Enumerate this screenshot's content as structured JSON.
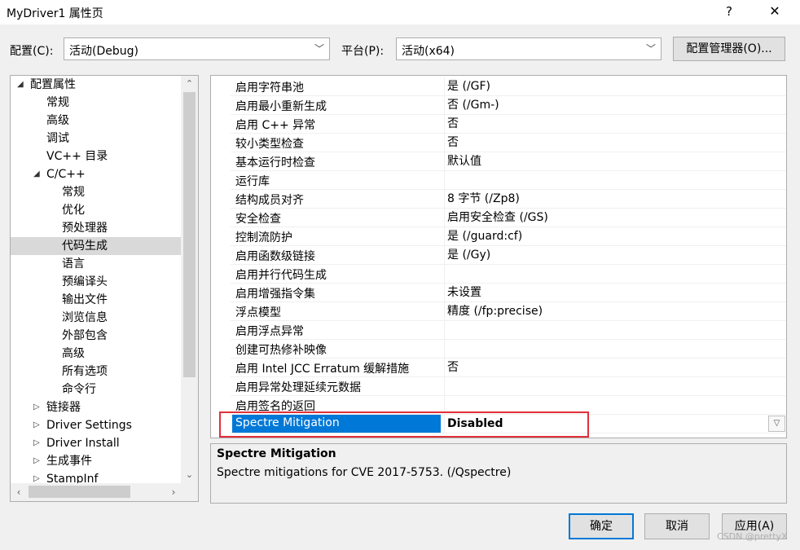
{
  "window": {
    "title": "MyDriver1 属性页",
    "help": "?",
    "close": "✕"
  },
  "config": {
    "label": "配置(C):",
    "value": "活动(Debug)",
    "platform_label": "平台(P):",
    "platform_value": "活动(x64)",
    "manager_button": "配置管理器(O)..."
  },
  "tree": {
    "items": [
      {
        "label": "配置属性",
        "arrow": "◢"
      },
      {
        "label": "常规"
      },
      {
        "label": "高级"
      },
      {
        "label": "调试"
      },
      {
        "label": "VC++ 目录"
      },
      {
        "label": "C/C++",
        "arrow": "◢"
      },
      {
        "label": "常规"
      },
      {
        "label": "优化"
      },
      {
        "label": "预处理器"
      },
      {
        "label": "代码生成"
      },
      {
        "label": "语言"
      },
      {
        "label": "预编译头"
      },
      {
        "label": "输出文件"
      },
      {
        "label": "浏览信息"
      },
      {
        "label": "外部包含"
      },
      {
        "label": "高级"
      },
      {
        "label": "所有选项"
      },
      {
        "label": "命令行"
      },
      {
        "label": "链接器",
        "arrow": "▷"
      },
      {
        "label": "Driver Settings",
        "arrow": "▷"
      },
      {
        "label": "Driver Install",
        "arrow": "▷"
      },
      {
        "label": "生成事件",
        "arrow": "▷"
      },
      {
        "label": "StampInf",
        "arrow": "▷"
      }
    ],
    "selected_index": 9
  },
  "grid": {
    "rows": [
      {
        "name": "启用字符串池",
        "value": "是 (/GF)"
      },
      {
        "name": "启用最小重新生成",
        "value": "否 (/Gm-)"
      },
      {
        "name": "启用 C++ 异常",
        "value": "否"
      },
      {
        "name": "较小类型检查",
        "value": "否"
      },
      {
        "name": "基本运行时检查",
        "value": "默认值"
      },
      {
        "name": "运行库",
        "value": ""
      },
      {
        "name": "结构成员对齐",
        "value": "8 字节 (/Zp8)"
      },
      {
        "name": "安全检查",
        "value": "启用安全检查 (/GS)"
      },
      {
        "name": "控制流防护",
        "value": "是 (/guard:cf)"
      },
      {
        "name": "启用函数级链接",
        "value": "是 (/Gy)"
      },
      {
        "name": "启用并行代码生成",
        "value": ""
      },
      {
        "name": "启用增强指令集",
        "value": "未设置"
      },
      {
        "name": "浮点模型",
        "value": "精度 (/fp:precise)"
      },
      {
        "name": "启用浮点异常",
        "value": ""
      },
      {
        "name": "创建可热修补映像",
        "value": ""
      },
      {
        "name": "启用 Intel JCC Erratum 缓解措施",
        "value": "否"
      },
      {
        "name": "启用异常处理延续元数据",
        "value": ""
      },
      {
        "name": "启用签名的返回",
        "value": ""
      },
      {
        "name": "Spectre Mitigation",
        "value": "Disabled"
      }
    ],
    "selected_index": 18,
    "dropdown_glyph": "▽"
  },
  "description": {
    "title": "Spectre Mitigation",
    "text": "Spectre mitigations for CVE 2017-5753.     (/Qspectre)"
  },
  "buttons": {
    "ok": "确定",
    "cancel": "取消",
    "apply": "应用(A)"
  },
  "watermark": "CSDN @prettyX",
  "colors": {
    "selection": "#0078d7",
    "highlight_box": "#e0303a"
  }
}
